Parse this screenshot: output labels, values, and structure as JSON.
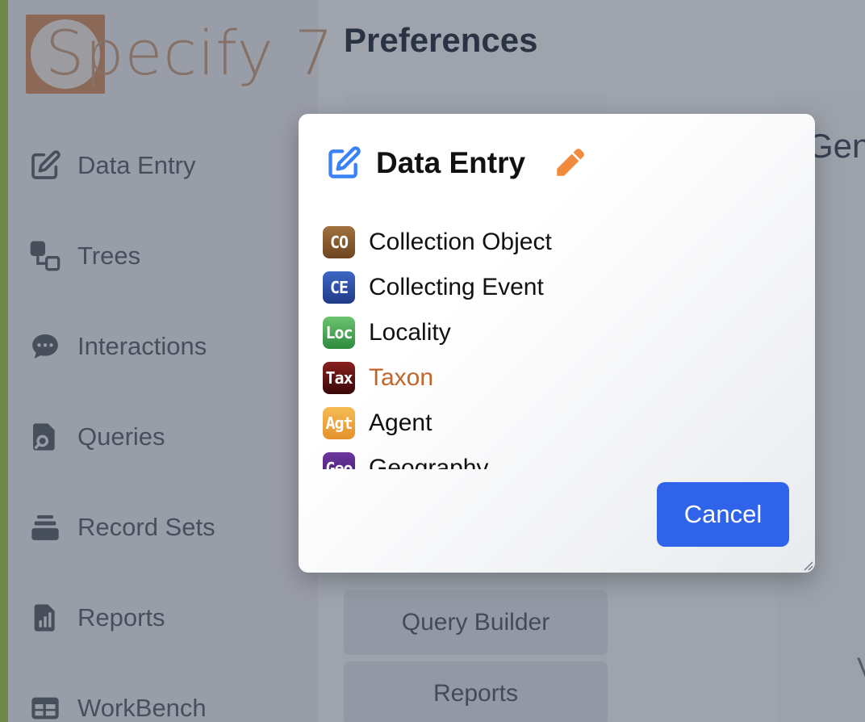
{
  "app": {
    "logo_text": "Specify 7",
    "accent_color": "#9cc444"
  },
  "sidebar": {
    "items": [
      {
        "label": "Data Entry",
        "icon": "pencil-square-icon"
      },
      {
        "label": "Trees",
        "icon": "tree-nodes-icon"
      },
      {
        "label": "Interactions",
        "icon": "chat-bubble-icon"
      },
      {
        "label": "Queries",
        "icon": "document-search-icon"
      },
      {
        "label": "Record Sets",
        "icon": "stack-icon"
      },
      {
        "label": "Reports",
        "icon": "report-chart-icon"
      },
      {
        "label": "WorkBench",
        "icon": "table-icon"
      }
    ]
  },
  "main": {
    "title": "Preferences",
    "side_buttons": [
      "Query Builder",
      "Reports"
    ],
    "right_heading": "Gen",
    "right_partial_text": "V"
  },
  "dialog": {
    "title": "Data Entry",
    "title_icon": "pencil-square-icon",
    "edit_icon": "pencil-icon",
    "items": [
      {
        "badge": "CO",
        "label": "Collection Object",
        "color": "#8a5a2b"
      },
      {
        "badge": "CE",
        "label": "Collecting Event",
        "color": "#2b4fa8"
      },
      {
        "badge": "Loc",
        "label": "Locality",
        "color": "#4caa55"
      },
      {
        "badge": "Tax",
        "label": "Taxon",
        "color": "#6b1515",
        "active": true
      },
      {
        "badge": "Agt",
        "label": "Agent",
        "color": "#f0a83a"
      },
      {
        "badge": "Geo",
        "label": "Geography",
        "color": "#5b2a86"
      }
    ],
    "cancel_label": "Cancel",
    "primary_color": "#2f63e9",
    "active_color": "#c0662a"
  }
}
